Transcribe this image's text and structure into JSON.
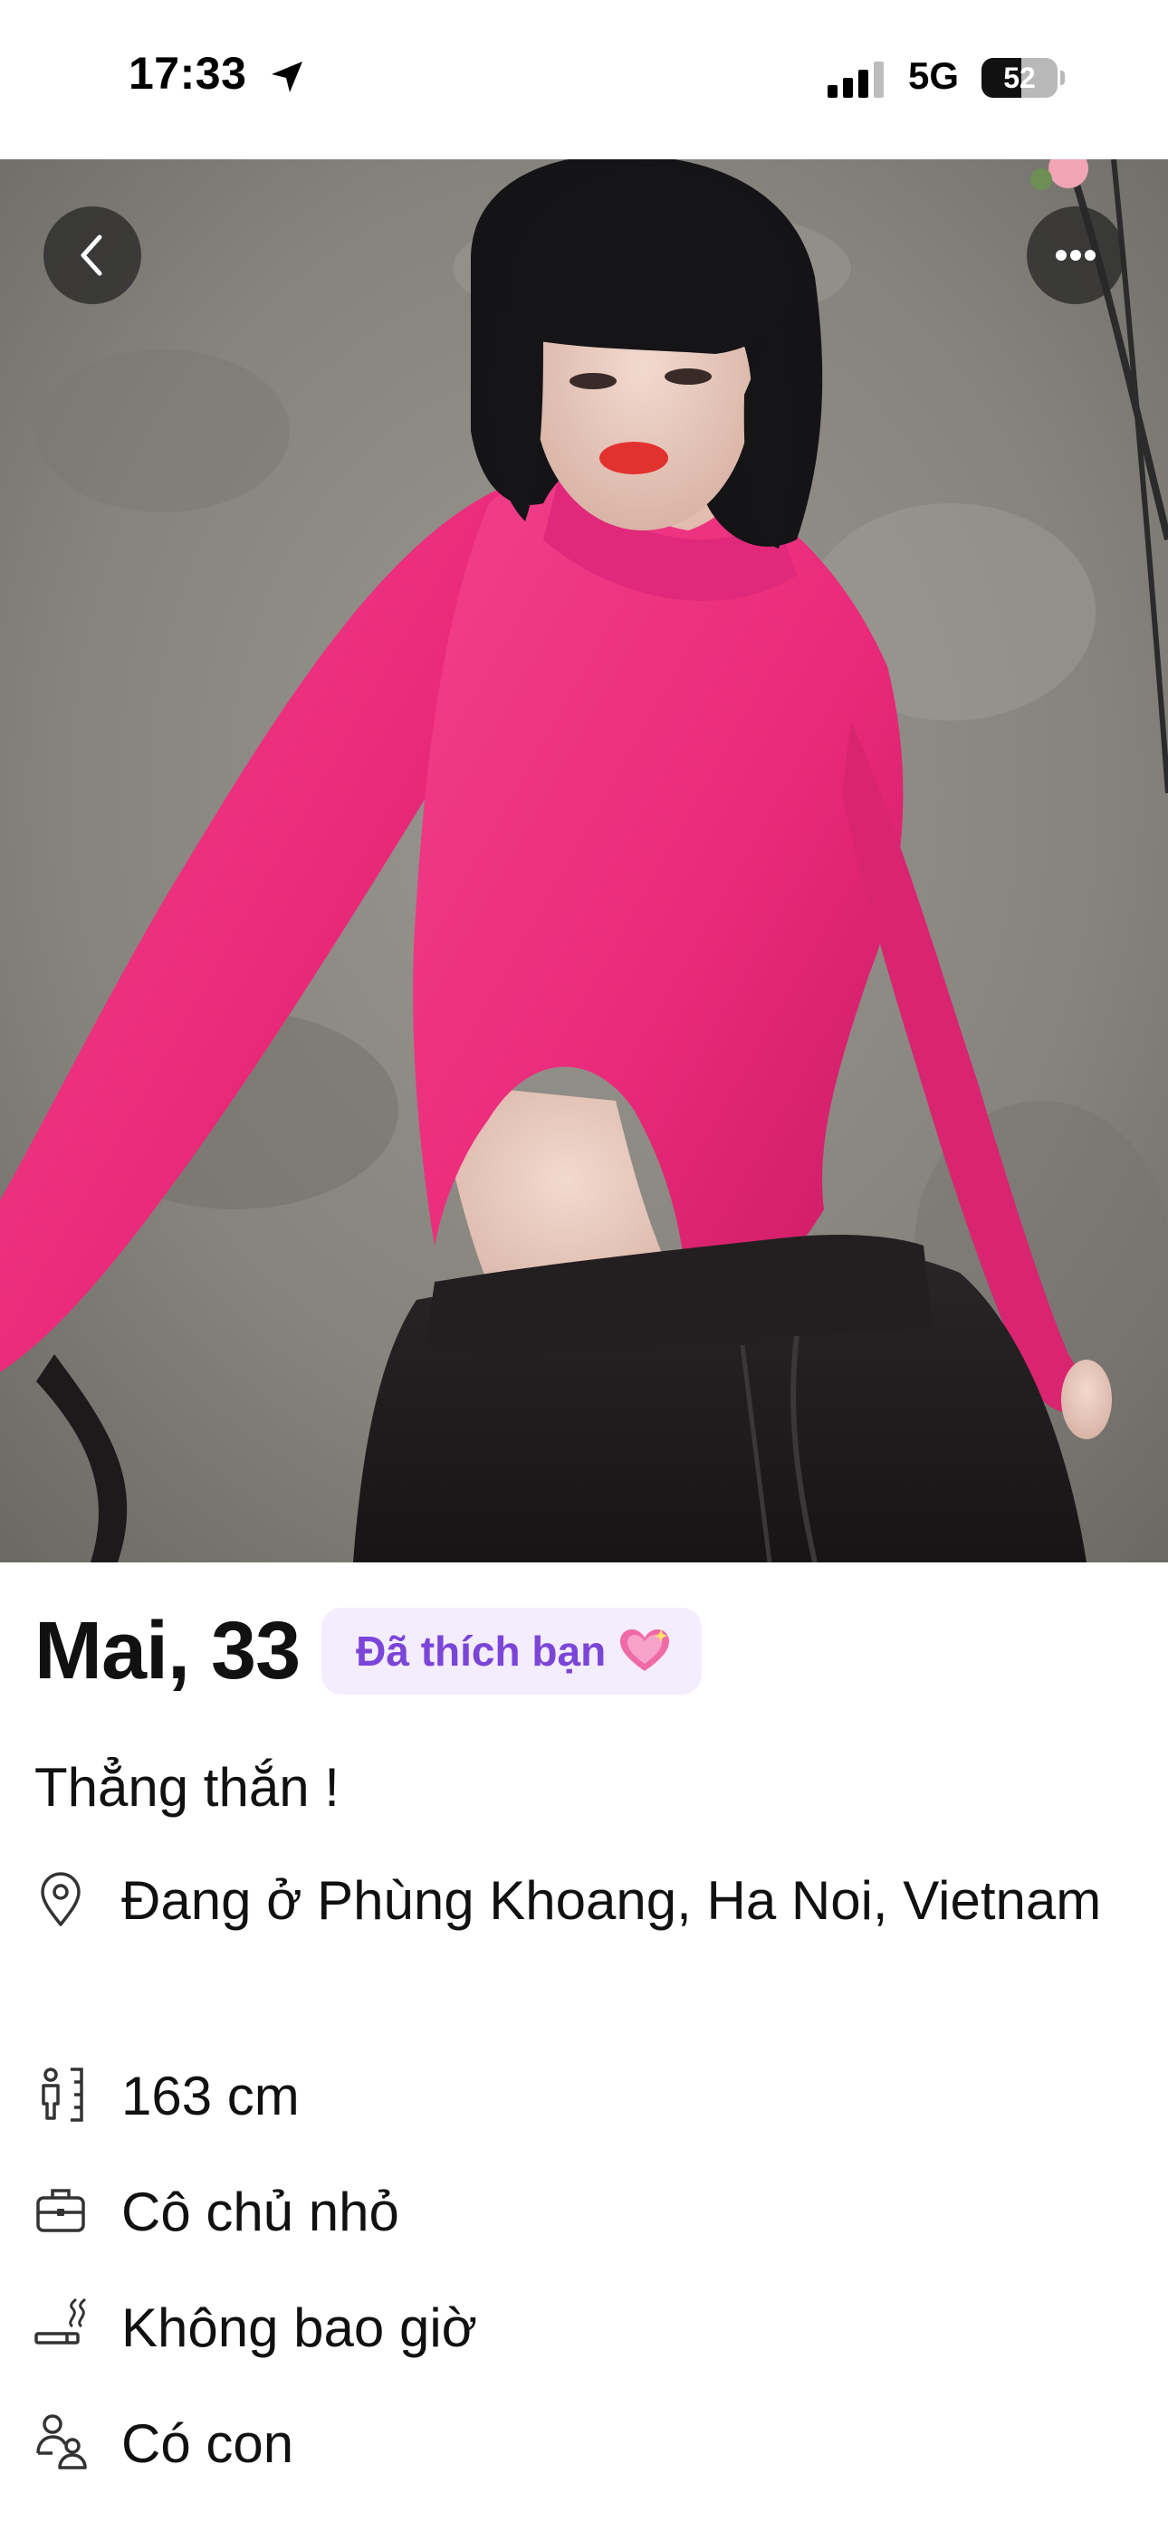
{
  "status_bar": {
    "time": "17:33",
    "network": "5G",
    "battery_level": "52",
    "battery_fraction": 0.52
  },
  "photo": {
    "description_icon": "profile-photo",
    "back_icon": "chevron-left-icon",
    "more_icon": "more-horizontal-icon"
  },
  "profile": {
    "name_age": "Mai, 33",
    "liked_badge": "Đã thích bạn",
    "liked_badge_icon": "sparkling-heart-icon",
    "bio": "Thẳng thắn !",
    "details": [
      {
        "icon": "location-pin-icon",
        "text": "Đang ở Phùng Khoang, Ha Noi, Vietnam"
      },
      {
        "icon": "height-icon",
        "text": "163 cm"
      },
      {
        "icon": "briefcase-icon",
        "text": "Cô chủ nhỏ"
      },
      {
        "icon": "smoking-icon",
        "text": "Không bao giờ"
      },
      {
        "icon": "children-icon",
        "text": "Có con"
      }
    ]
  },
  "colors": {
    "badge_background": "#f3edfd",
    "badge_text": "#7b45d8",
    "overlay_button": "#282828",
    "top_pink": "#f0287c"
  }
}
